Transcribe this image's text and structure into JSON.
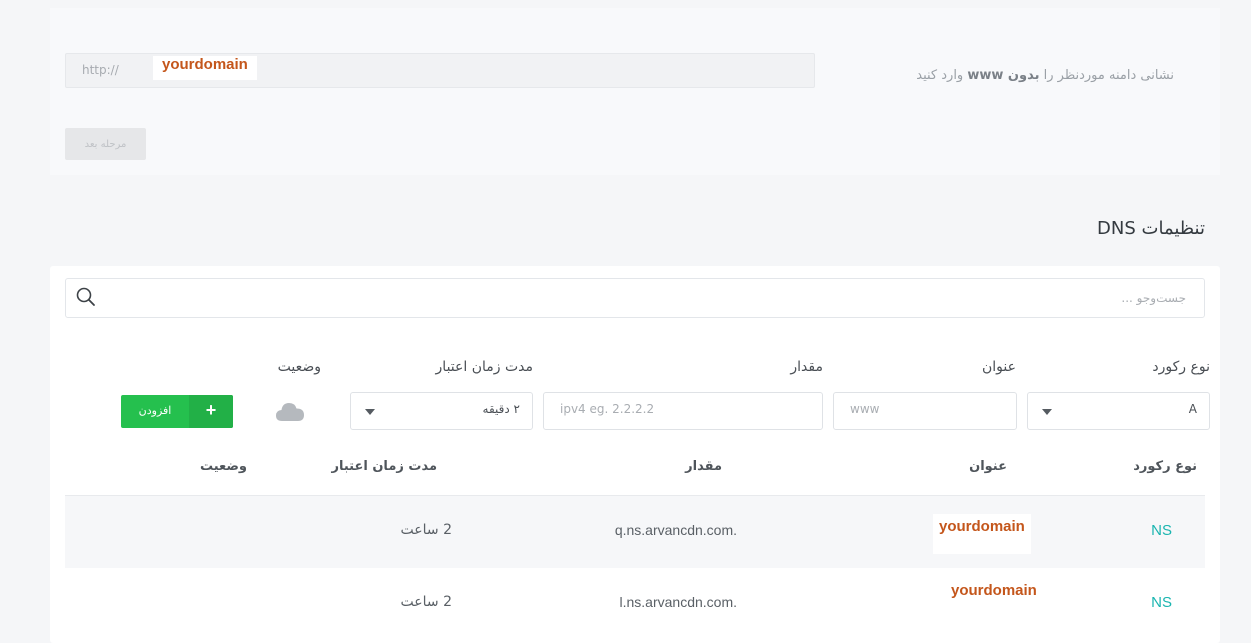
{
  "domain_step": {
    "label_prefix": "نشانی دامنه موردنظر را",
    "label_bold": "بدون www",
    "label_suffix": "وارد کنید",
    "prefix": "http://",
    "value": "yourdomain",
    "next_label": "مرحله بعد"
  },
  "dns": {
    "title": "تنظیمات DNS",
    "search_placeholder": "جست‌وجو ...",
    "form": {
      "record_type_label": "نوع رکورد",
      "record_type_value": "A",
      "name_label": "عنوان",
      "name_placeholder": "www",
      "value_label": "مقدار",
      "value_placeholder": "ipv4 eg. 2.2.2.2",
      "ttl_label": "مدت زمان اعتبار",
      "ttl_value": "۲ دقیقه",
      "status_label": "وضعیت",
      "add_label": "افزودن",
      "add_icon": "plus-icon",
      "status_icon": "cloud-icon"
    },
    "table": {
      "headers": {
        "type": "نوع رکورد",
        "name": "عنوان",
        "value": "مقدار",
        "ttl": "مدت زمان اعتبار",
        "status": "وضعیت"
      },
      "rows": [
        {
          "type": "NS",
          "name": "yourdomain",
          "value": "q.ns.arvancdn.com.",
          "ttl": "2 ساعت"
        },
        {
          "type": "NS",
          "name": "yourdomain",
          "value": "l.ns.arvancdn.com.",
          "ttl": "2 ساعت"
        }
      ]
    }
  },
  "colors": {
    "accent_green": "#25c04e",
    "ns_teal": "#1ab5b0",
    "domain_orange": "#c4561b"
  }
}
